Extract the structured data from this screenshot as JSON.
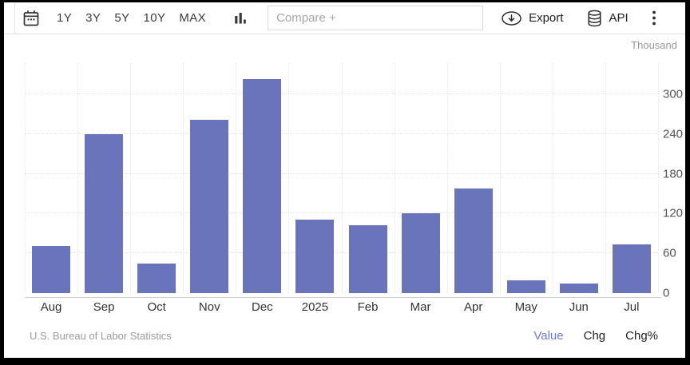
{
  "toolbar": {
    "range_buttons": [
      "1Y",
      "3Y",
      "5Y",
      "10Y",
      "MAX"
    ],
    "compare_placeholder": "Compare +",
    "export_label": "Export",
    "api_label": "API",
    "icons": {
      "calendar": "calendar-icon",
      "chart_type": "column-chart-icon",
      "export": "cloud-download-icon",
      "api": "database-icon",
      "more": "kebab-menu-icon"
    }
  },
  "chart_data": {
    "type": "bar",
    "title": "",
    "unit_label": "Thousand",
    "categories": [
      "Aug",
      "Sep",
      "Oct",
      "Nov",
      "Dec",
      "2025",
      "Feb",
      "Mar",
      "Apr",
      "May",
      "Jun",
      "Jul"
    ],
    "values": [
      71,
      240,
      44,
      261,
      323,
      111,
      102,
      120,
      158,
      19,
      14,
      73
    ],
    "y_ticks": [
      0,
      60,
      120,
      180,
      240,
      300
    ],
    "ylim": [
      0,
      347
    ],
    "xlabel": "",
    "ylabel": "Thousand",
    "grid": true,
    "legend_position": "none",
    "bar_color": "#6a74ba",
    "source": "U.S. Bureau of Labor Statistics"
  },
  "footer": {
    "source": "U.S. Bureau of Labor Statistics",
    "links": [
      {
        "label": "Value",
        "active": true
      },
      {
        "label": "Chg",
        "active": false
      },
      {
        "label": "Chg%",
        "active": false
      }
    ],
    "accent_color": "#6b7ae0",
    "text_color": "#222222"
  }
}
